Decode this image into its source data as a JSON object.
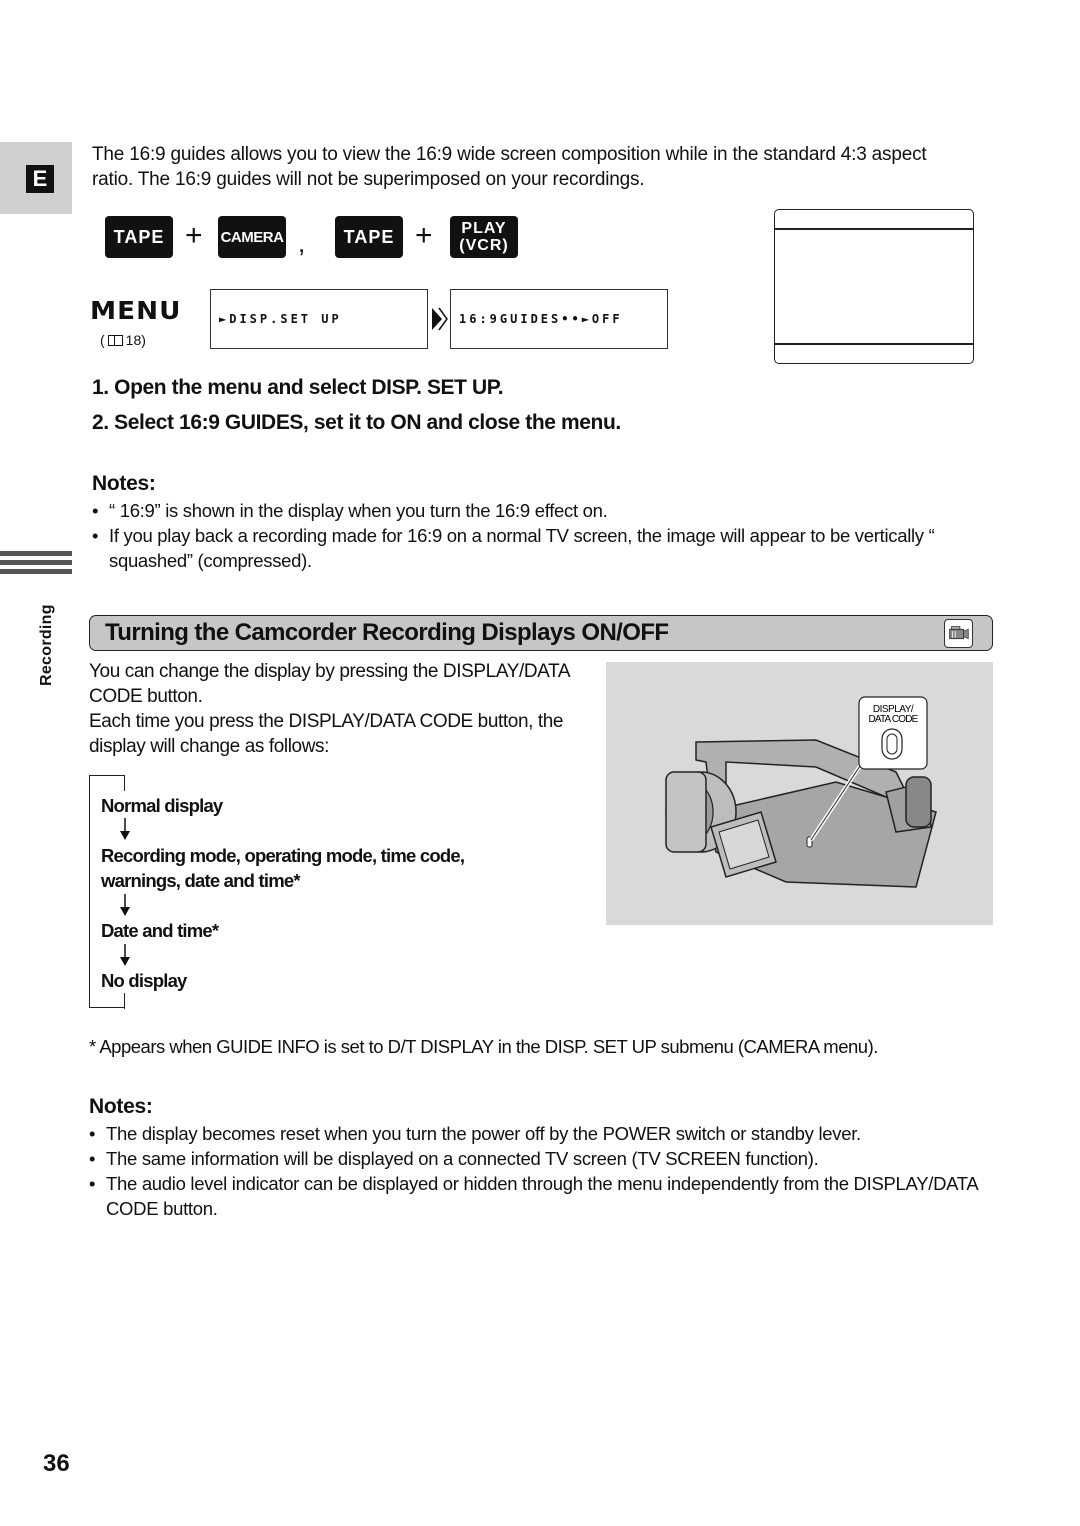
{
  "page": {
    "language_tab": "E",
    "side_label": "Recording",
    "page_number": "36"
  },
  "intro": {
    "text": "The 16:9 guides allows you to view the 16:9 wide screen composition while in the standard 4:3 aspect ratio. The 16:9 guides will not be superimposed on your recordings."
  },
  "mode_keys": {
    "key1": "TAPE",
    "plus": "+",
    "key2": "CAMERA",
    "separator": ",",
    "key3": "TAPE",
    "key4_line1": "PLAY",
    "key4_line2": "(VCR)"
  },
  "menu": {
    "label": "MENU",
    "ref_open": "(",
    "ref_page": "18)",
    "box1": "►DISP.SET UP",
    "box2": "16:9GUIDES••►OFF"
  },
  "steps": [
    "1.  Open the menu and select DISP. SET UP.",
    "2.  Select 16:9 GUIDES, set it to ON and close the menu."
  ],
  "notes1": {
    "title": "Notes:",
    "items": [
      "“ 16:9”  is shown in the display when you turn the 16:9 effect on.",
      "If you play back a recording made for 16:9 on a normal TV screen, the image will appear to be vertically “ squashed”  (compressed)."
    ]
  },
  "section": {
    "title": "Turning the Camcorder Recording Displays ON/OFF",
    "mode_icon": "camera-mode-icon",
    "paragraph_1": "You can change the display by pressing the DISPLAY/DATA CODE button.",
    "paragraph_2": "Each time you press the DISPLAY/DATA CODE button, the display will change as follows:",
    "flow": [
      "Normal display",
      "Recording mode, operating mode, time code, warnings, date and time*",
      "Date and time*",
      "No display"
    ],
    "illustration_callout_line1": "DISPLAY/",
    "illustration_callout_line2": "DATA CODE"
  },
  "footnote": "*  Appears when GUIDE INFO is set to D/T DISPLAY in the DISP. SET UP submenu (CAMERA menu).",
  "notes2": {
    "title": "Notes:",
    "items": [
      "The display becomes reset when you turn the power off by the POWER switch or standby lever.",
      "The same information will be displayed on a connected TV screen (TV SCREEN function).",
      "The audio level indicator can be displayed or hidden through the menu independently from the DISPLAY/DATA CODE button."
    ]
  }
}
